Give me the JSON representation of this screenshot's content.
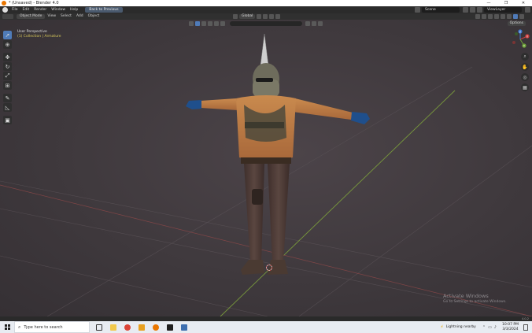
{
  "window": {
    "title": "* (Unsaved) - Blender 4.0",
    "buttons": [
      "—",
      "❐",
      "✕"
    ]
  },
  "topbar": {
    "menus": [
      "File",
      "Edit",
      "Render",
      "Window",
      "Help"
    ],
    "workspace_tab": "Back to Previous",
    "scene": "Scene",
    "view_layer": "ViewLayer"
  },
  "viewport_header": {
    "mode": "Object Mode",
    "menus": [
      "View",
      "Select",
      "Add",
      "Object"
    ],
    "orientation": "Global",
    "options": "Options"
  },
  "viewport": {
    "perspective_label": "User Perspective",
    "collection_label": "(1) Collection | Armature",
    "search_placeholder": ""
  },
  "gizmo": {
    "x_label": "X",
    "y_label": "Y",
    "z_label": "Z"
  },
  "watermark": {
    "title": "Activate Windows",
    "subtitle": "Go to Settings to activate Windows."
  },
  "statusbar": {
    "version": "4.0.2"
  },
  "taskbar": {
    "search_placeholder": "Type here to search",
    "weather": "Lightning nearby",
    "time": "10:07 PM",
    "date": "3/3/2024"
  },
  "colors": {
    "accent": "#4f7bb8",
    "blender_orange": "#ea7600",
    "floor_grid": "#5a5257",
    "y_axis": "#7ea33c",
    "x_axis": "#9a4a4a"
  }
}
